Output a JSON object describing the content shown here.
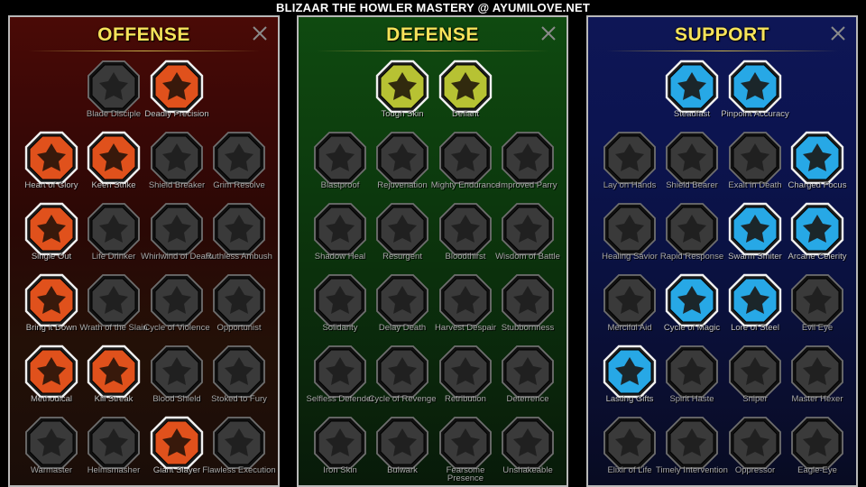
{
  "page_title": "BLIZAAR THE HOWLER MASTERY @ AYUMILOVE.NET",
  "colors": {
    "offense_active": "#e0511c",
    "defense_active": "#b7c233",
    "support_active": "#27a8e6",
    "inactive": "#3a3a3a",
    "header_text": "#f6e35a"
  },
  "offense": {
    "title": "OFFENSE",
    "close_icon": "close-x-icon",
    "skills": [
      {
        "label": "Blade Disciple",
        "icon": "crossed-swords-icon",
        "active": false
      },
      {
        "label": "Deadly Precision",
        "icon": "sword-strike-icon",
        "active": true
      },
      {
        "label": "Heart of Glory",
        "icon": "horned-warrior-icon",
        "active": true
      },
      {
        "label": "Keen Strike",
        "icon": "slashing-blades-icon",
        "active": true
      },
      {
        "label": "Shield Breaker",
        "icon": "shield-strike-icon",
        "active": false
      },
      {
        "label": "Grim Resolve",
        "icon": "crowned-heart-icon",
        "active": false
      },
      {
        "label": "Single Out",
        "icon": "pointed-hands-icon",
        "active": true
      },
      {
        "label": "Life Drinker",
        "icon": "fanged-mouth-icon",
        "active": false
      },
      {
        "label": "Whirlwind of Death",
        "icon": "whirlwind-icon",
        "active": false
      },
      {
        "label": "Ruthless Ambush",
        "icon": "dagger-hand-icon",
        "active": false
      },
      {
        "label": "Bring it Down",
        "icon": "falling-sword-icon",
        "active": true
      },
      {
        "label": "Wrath of the Slain",
        "icon": "raised-fist-icon",
        "active": false
      },
      {
        "label": "Cycle of Violence",
        "icon": "cycling-axes-icon",
        "active": false
      },
      {
        "label": "Opportunist",
        "icon": "chain-lightning-icon",
        "active": false
      },
      {
        "label": "Methodical",
        "icon": "clawed-hand-icon",
        "active": true
      },
      {
        "label": "Kill Streak",
        "icon": "skull-icon",
        "active": true
      },
      {
        "label": "Blood Shield",
        "icon": "sword-shield-icon",
        "active": false
      },
      {
        "label": "Stoked to Fury",
        "icon": "raging-warrior-icon",
        "active": false
      },
      {
        "label": "Warmaster",
        "icon": "war-sword-icon",
        "active": false
      },
      {
        "label": "Helmsmasher",
        "icon": "helmet-icon",
        "active": false
      },
      {
        "label": "Giant Slayer",
        "icon": "giant-icon",
        "active": true
      },
      {
        "label": "Flawless Execution",
        "icon": "executioner-icon",
        "active": false
      }
    ]
  },
  "defense": {
    "title": "DEFENSE",
    "close_icon": "close-x-icon",
    "skills": [
      {
        "label": "Tough Skin",
        "icon": "armor-plates-icon",
        "active": true
      },
      {
        "label": "Defiant",
        "icon": "fist-icon",
        "active": true
      },
      {
        "label": "Blastproof",
        "icon": "chest-armor-icon",
        "active": false
      },
      {
        "label": "Rejuvenation",
        "icon": "heart-flame-icon",
        "active": false
      },
      {
        "label": "Mighty Endurance",
        "icon": "muscled-body-icon",
        "active": false
      },
      {
        "label": "Improved Parry",
        "icon": "parry-blades-icon",
        "active": false
      },
      {
        "label": "Shadow Heal",
        "icon": "kneeling-figure-icon",
        "active": false
      },
      {
        "label": "Resurgent",
        "icon": "knight-shield-icon",
        "active": false
      },
      {
        "label": "Bloodthirst",
        "icon": "heart-skull-icon",
        "active": false
      },
      {
        "label": "Wisdom of Battle",
        "icon": "spiral-head-icon",
        "active": false
      },
      {
        "label": "Solidarity",
        "icon": "raised-hands-icon",
        "active": false
      },
      {
        "label": "Delay Death",
        "icon": "hourglass-icon",
        "active": false
      },
      {
        "label": "Harvest Despair",
        "icon": "open-hand-icon",
        "active": false
      },
      {
        "label": "Stubbornness",
        "icon": "bull-head-icon",
        "active": false
      },
      {
        "label": "Selfless Defender",
        "icon": "defender-icon",
        "active": false
      },
      {
        "label": "Cycle of Revenge",
        "icon": "flame-circle-icon",
        "active": false
      },
      {
        "label": "Retribution",
        "icon": "burning-skull-icon",
        "active": false
      },
      {
        "label": "Deterrence",
        "icon": "blade-arc-icon",
        "active": false
      },
      {
        "label": "Iron Skin",
        "icon": "iron-face-icon",
        "active": false
      },
      {
        "label": "Bulwark",
        "icon": "bulwark-shield-icon",
        "active": false
      },
      {
        "label": "Fearsome Presence",
        "icon": "demon-face-icon",
        "active": false
      },
      {
        "label": "Unshakeable",
        "icon": "stone-body-icon",
        "active": false
      }
    ]
  },
  "support": {
    "title": "SUPPORT",
    "close_icon": "close-x-icon",
    "skills": [
      {
        "label": "Steadfast",
        "icon": "heart-sparkle-icon",
        "active": true
      },
      {
        "label": "Pinpoint Accuracy",
        "icon": "target-hand-icon",
        "active": true
      },
      {
        "label": "Lay on Hands",
        "icon": "praying-hands-icon",
        "active": false
      },
      {
        "label": "Shield Bearer",
        "icon": "aura-shield-icon",
        "active": false
      },
      {
        "label": "Exalt in Death",
        "icon": "skull-smoke-icon",
        "active": false
      },
      {
        "label": "Charged Focus",
        "icon": "charged-hand-icon",
        "active": true
      },
      {
        "label": "Healing Savior",
        "icon": "healing-figure-icon",
        "active": false
      },
      {
        "label": "Rapid Response",
        "icon": "lightning-shield-icon",
        "active": false
      },
      {
        "label": "Swarm Smiter",
        "icon": "lightning-swarm-icon",
        "active": true
      },
      {
        "label": "Arcane Celerity",
        "icon": "speed-figures-icon",
        "active": true
      },
      {
        "label": "Merciful Aid",
        "icon": "chained-heart-icon",
        "active": false
      },
      {
        "label": "Cycle of Magic",
        "icon": "comet-icon",
        "active": true
      },
      {
        "label": "Lore of Steel",
        "icon": "open-book-icon",
        "active": true
      },
      {
        "label": "Evil Eye",
        "icon": "evil-eye-icon",
        "active": false
      },
      {
        "label": "Lasting Gifts",
        "icon": "compass-star-icon",
        "active": true
      },
      {
        "label": "Spirit Haste",
        "icon": "winged-boot-icon",
        "active": false
      },
      {
        "label": "Sniper",
        "icon": "eye-icon",
        "active": false
      },
      {
        "label": "Master Hexer",
        "icon": "hexer-icon",
        "active": false
      },
      {
        "label": "Elixir of Life",
        "icon": "potion-icon",
        "active": false
      },
      {
        "label": "Timely Intervention",
        "icon": "hooded-skull-icon",
        "active": false
      },
      {
        "label": "Oppressor",
        "icon": "crushing-fist-icon",
        "active": false
      },
      {
        "label": "Eagle-Eye",
        "icon": "eagle-icon",
        "active": false
      }
    ]
  }
}
